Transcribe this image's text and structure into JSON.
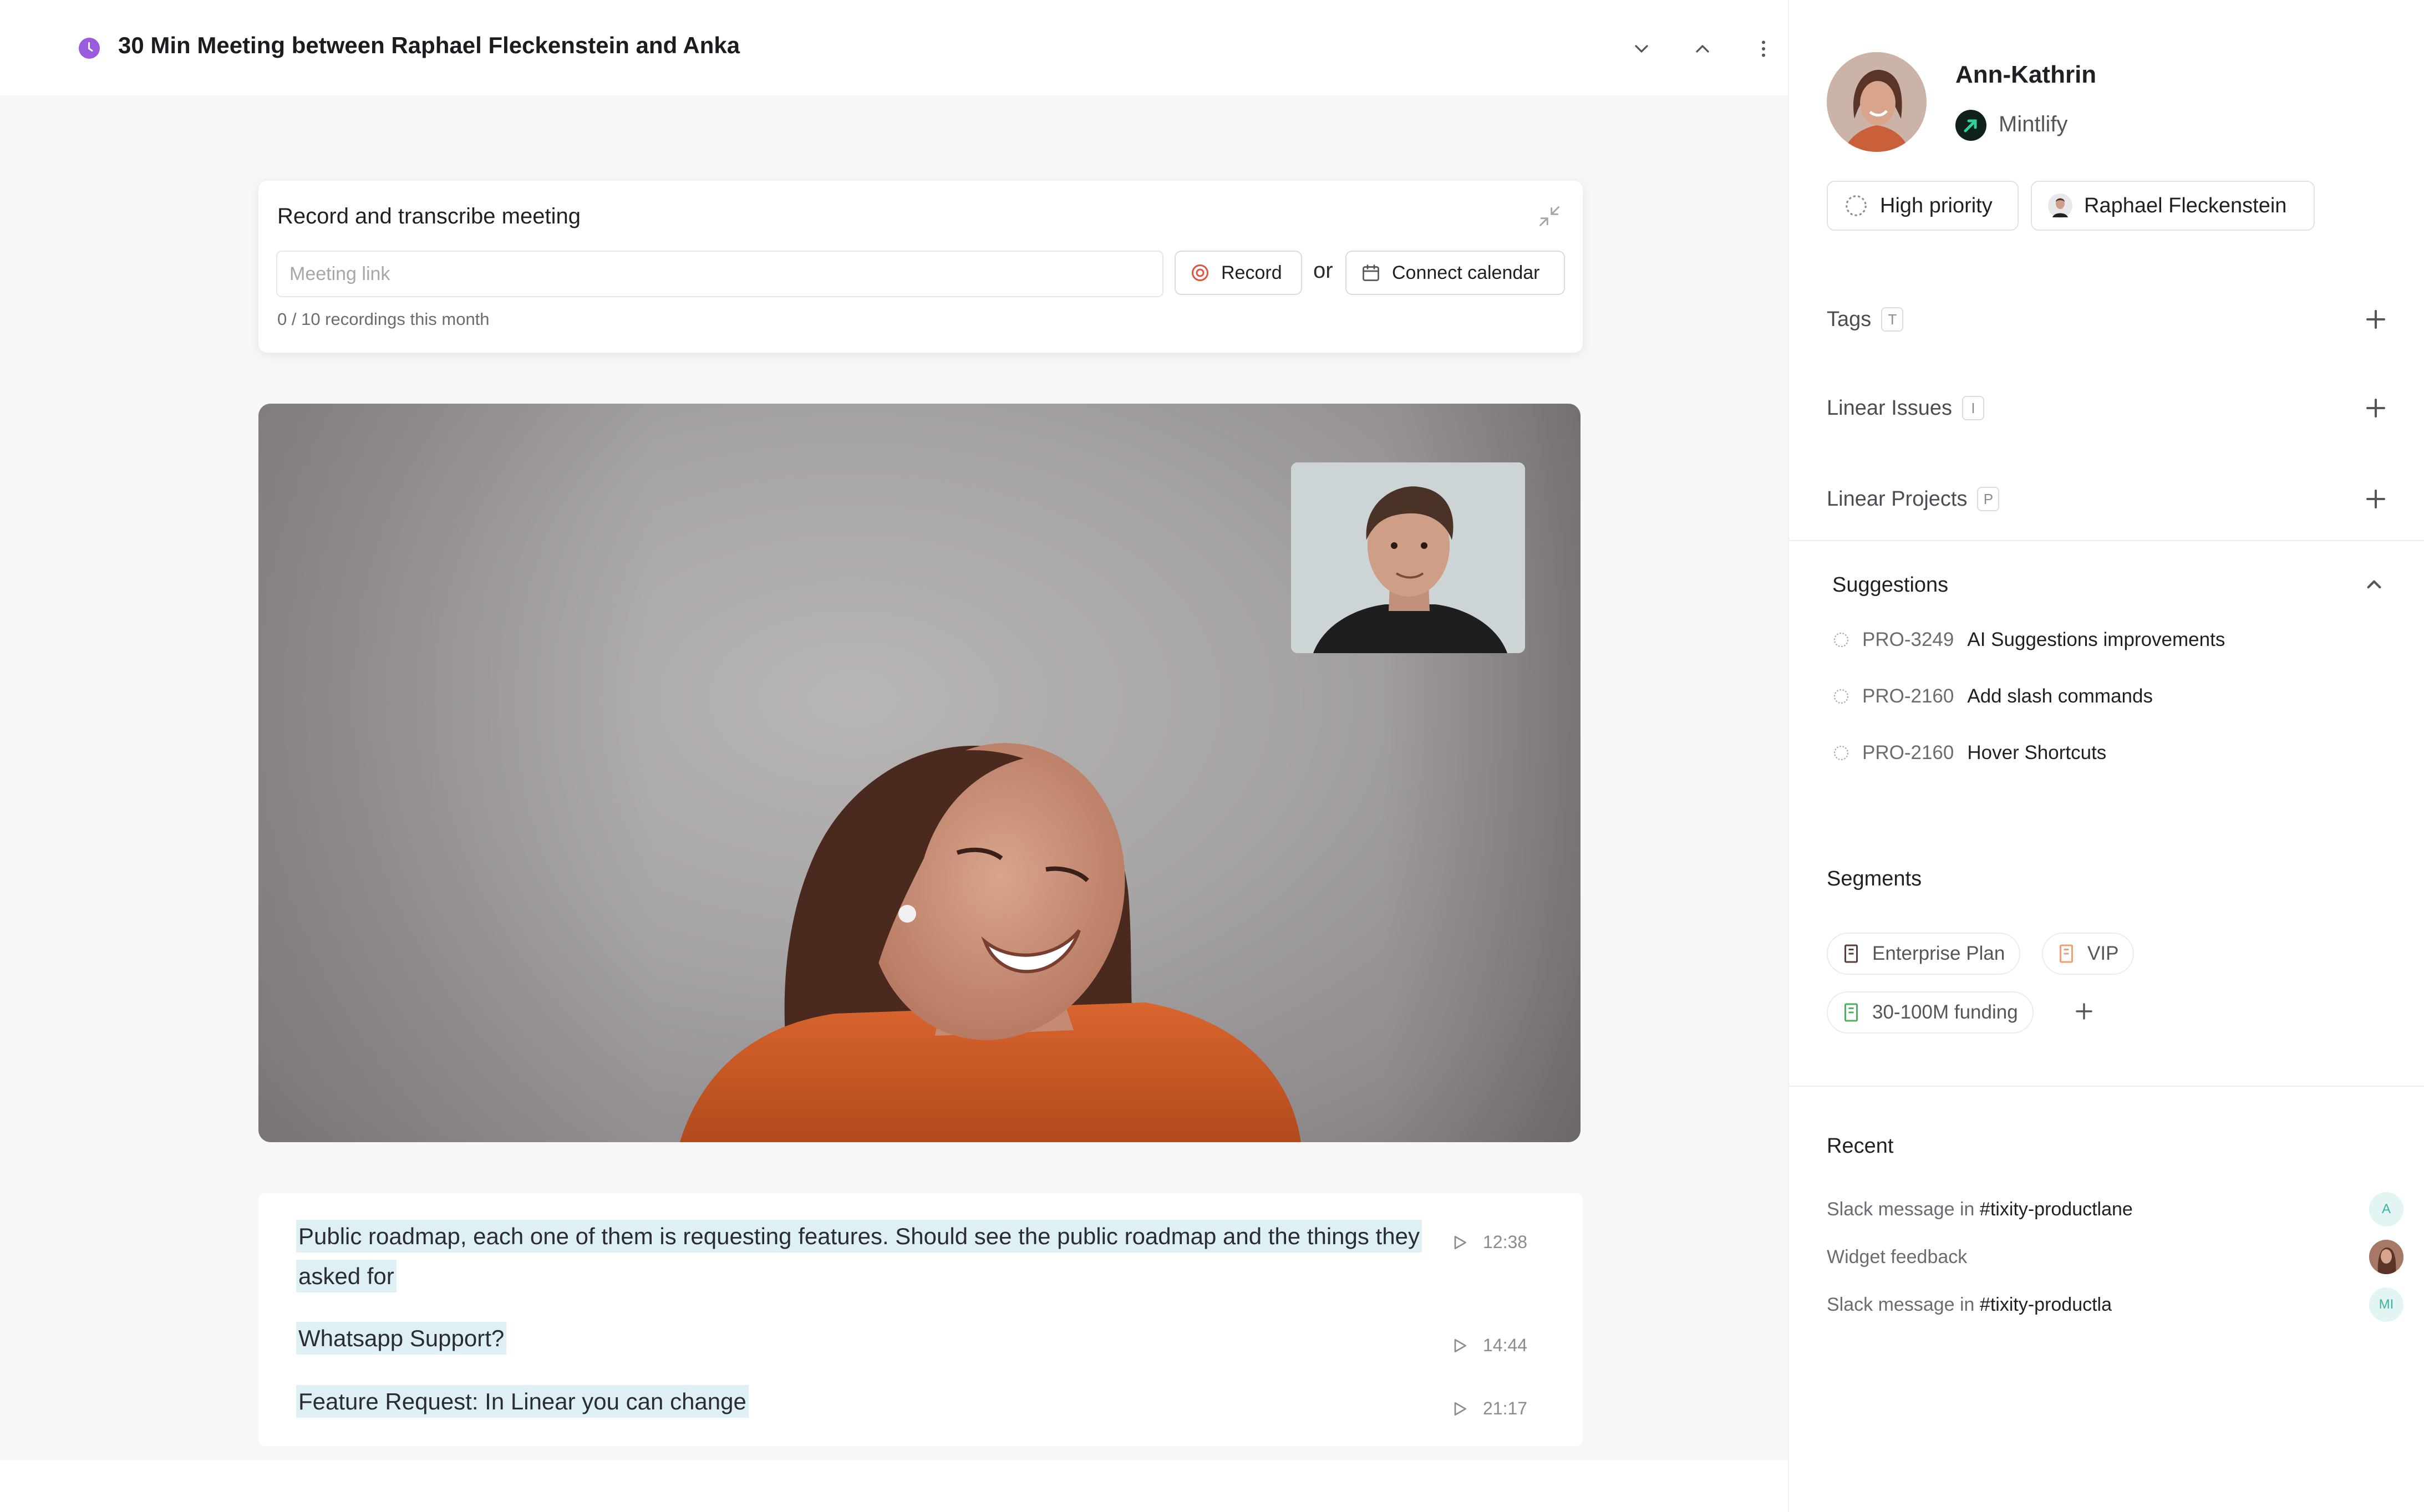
{
  "header": {
    "title": "30 Min Meeting between Raphael Fleckenstein and  Anka",
    "title_icon": "clock-icon",
    "accent_color": "#9a5bdc",
    "actions": [
      "chevron-down-icon",
      "chevron-up-icon",
      "more-vertical-icon"
    ]
  },
  "record_card": {
    "title": "Record and transcribe meeting",
    "meeting_link_placeholder": "Meeting link",
    "meeting_link_value": "",
    "record_label": "Record",
    "or_label": "or",
    "calendar_label": "Connect calendar",
    "recordings_count": "0 / 10 recordings this month"
  },
  "transcript": [
    {
      "text": "Public roadmap, each one of them is requesting features. Should see the public roadmap and the things they asked for",
      "time": "12:38"
    },
    {
      "text": "Whatsapp Support?",
      "time": "14:44"
    },
    {
      "text": "Feature Request: In Linear you can change",
      "time": "21:17"
    }
  ],
  "contact": {
    "name": "Ann-Kathrin",
    "company": "Mintlify",
    "priority": "High priority",
    "assignee": "Raphael Fleckenstein"
  },
  "properties": [
    {
      "label": "Tags",
      "shortcut": "T"
    },
    {
      "label": "Linear Issues",
      "shortcut": "I"
    },
    {
      "label": "Linear Projects",
      "shortcut": "P"
    }
  ],
  "suggestions": {
    "title": "Suggestions",
    "items": [
      {
        "id": "PRO-3249",
        "title": "AI Suggestions improvements"
      },
      {
        "id": "PRO-2160",
        "title": "Add slash commands"
      },
      {
        "id": "PRO-2160",
        "title": "Hover Shortcuts"
      }
    ]
  },
  "segments": {
    "title": "Segments",
    "items": [
      {
        "label": "Enterprise Plan",
        "color": "#5a3e36"
      },
      {
        "label": "VIP",
        "color": "#f0a070"
      },
      {
        "label": "30-100M funding",
        "color": "#4caf62"
      }
    ]
  },
  "recent": {
    "title": "Recent",
    "items": [
      {
        "prefix": "Slack message in ",
        "channel": "#tixity-productlane",
        "avatar": "A"
      },
      {
        "prefix": "Widget feedback",
        "channel": "",
        "avatar": ""
      },
      {
        "prefix": "Slack message in ",
        "channel": "#tixity-productla",
        "avatar": "MI"
      }
    ]
  }
}
